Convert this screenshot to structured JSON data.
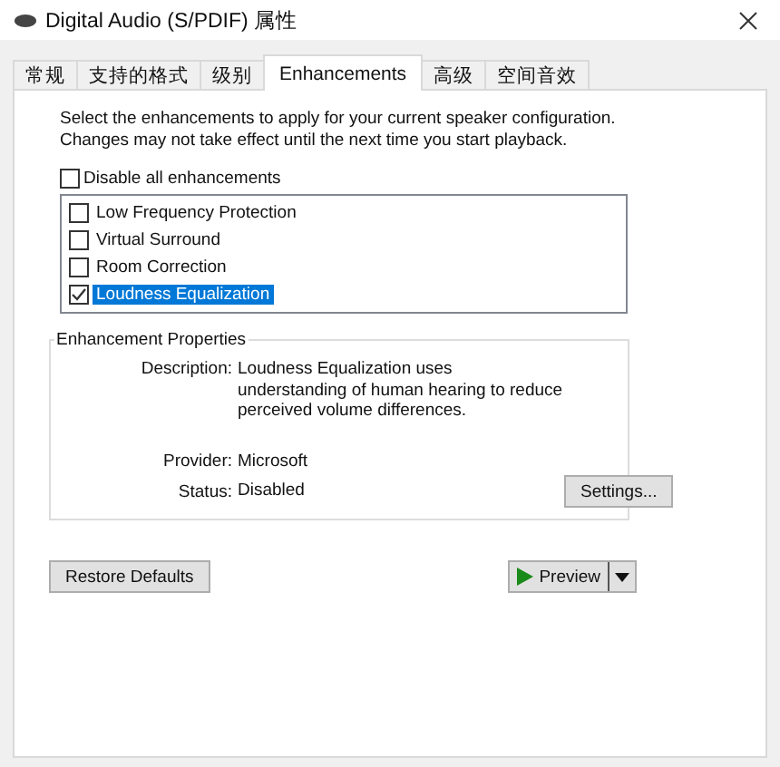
{
  "window": {
    "title": "Digital Audio (S/PDIF) 属性"
  },
  "tabs": [
    {
      "label": "常规",
      "selected": false
    },
    {
      "label": "支持的格式",
      "selected": false
    },
    {
      "label": "级别",
      "selected": false
    },
    {
      "label": "Enhancements",
      "selected": true
    },
    {
      "label": "高级",
      "selected": false
    },
    {
      "label": "空间音效",
      "selected": false
    }
  ],
  "intro": "Select the enhancements to apply for your current speaker configuration. Changes may not take effect until the next time you start playback.",
  "disable_all": {
    "label": "Disable all enhancements",
    "checked": false
  },
  "enhancements": [
    {
      "label": "Low Frequency Protection",
      "checked": false,
      "selected": false
    },
    {
      "label": "Virtual Surround",
      "checked": false,
      "selected": false
    },
    {
      "label": "Room Correction",
      "checked": false,
      "selected": false
    },
    {
      "label": "Loudness Equalization",
      "checked": true,
      "selected": true
    }
  ],
  "properties": {
    "title": "Enhancement Properties",
    "description_label": "Description:",
    "description": "Loudness Equalization uses understanding of human hearing to reduce perceived volume differences.",
    "provider_label": "Provider:",
    "provider": "Microsoft",
    "status_label": "Status:",
    "status": "Disabled",
    "settings_button": "Settings..."
  },
  "buttons": {
    "restore": "Restore Defaults",
    "preview": "Preview"
  }
}
